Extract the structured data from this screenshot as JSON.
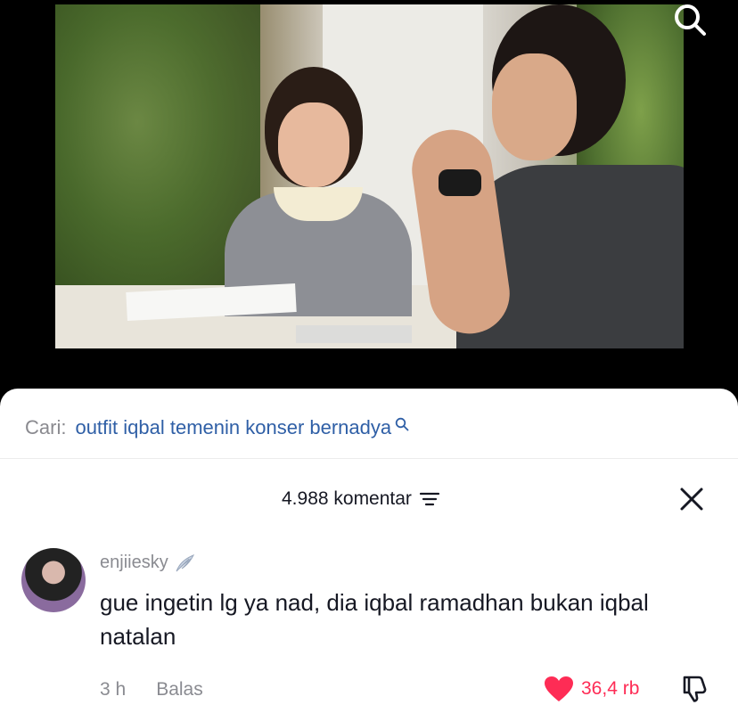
{
  "video": {
    "search_icon": "search-icon"
  },
  "search_suggestion": {
    "label": "Cari:",
    "query": "outfit iqbal temenin konser bernadya",
    "icon": "search-icon"
  },
  "comments_header": {
    "count_label": "4.988 komentar",
    "sort_icon": "sort-icon",
    "close_icon": "close-icon"
  },
  "comment": {
    "username": "enjiiesky",
    "badge_icon": "wing-icon",
    "text": "gue ingetin lg ya nad, dia iqbal ramadhan bukan iqbal natalan",
    "time": "3 h",
    "reply_label": "Balas",
    "likes": "36,4 rb",
    "like_color": "#fe2c55"
  }
}
